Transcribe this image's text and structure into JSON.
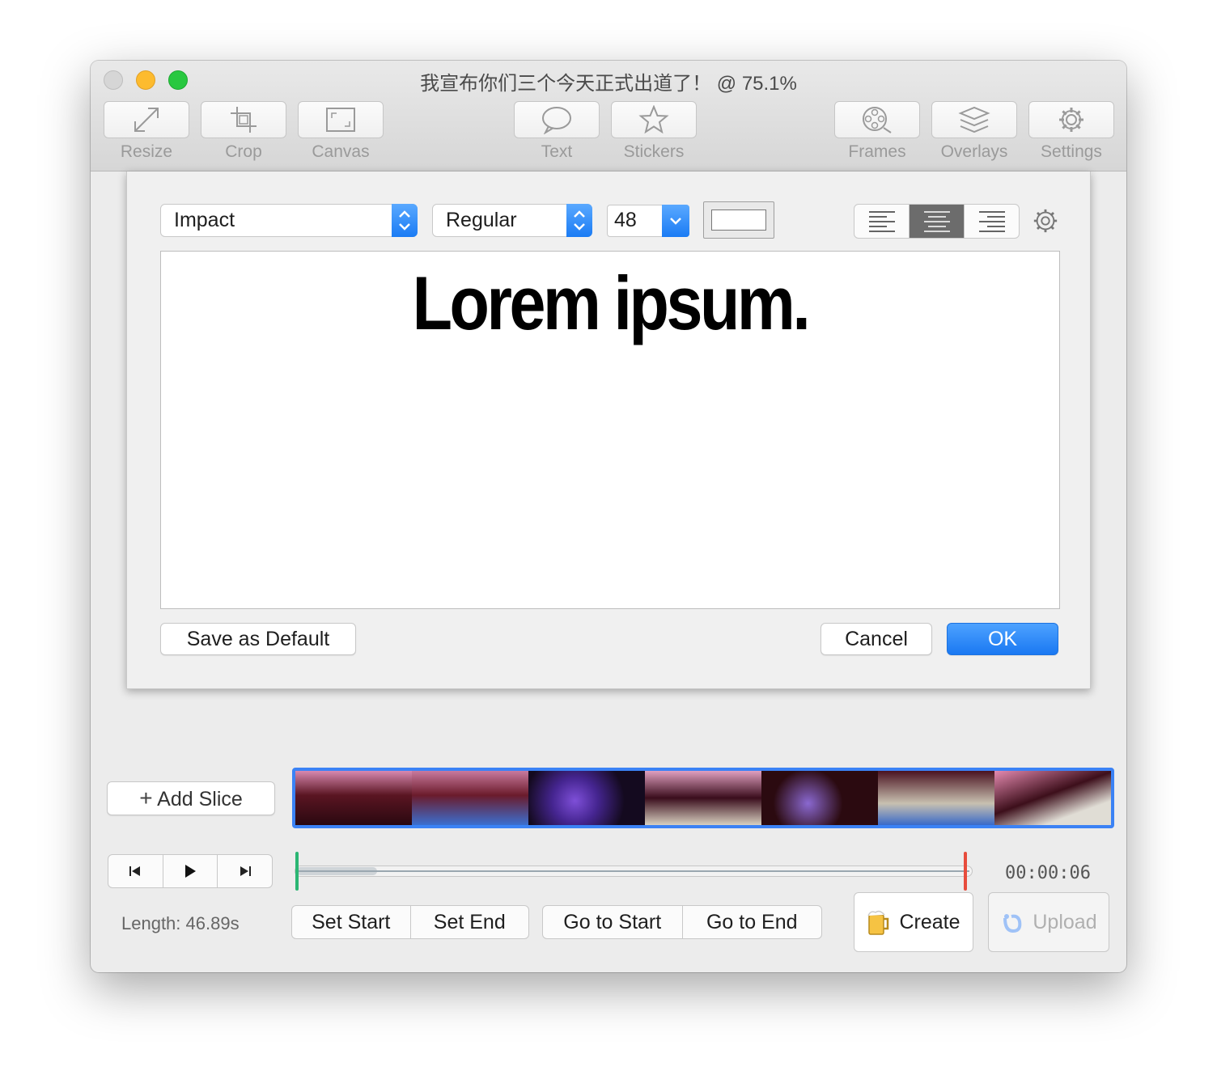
{
  "window": {
    "title": "我宣布你们三个今天正式出道了！  @ 75.1%"
  },
  "toolbar": {
    "items": [
      {
        "label": "Resize",
        "icon": "resize-icon"
      },
      {
        "label": "Crop",
        "icon": "crop-icon"
      },
      {
        "label": "Canvas",
        "icon": "canvas-icon"
      },
      {
        "label": "Text",
        "icon": "speech-bubble-icon"
      },
      {
        "label": "Stickers",
        "icon": "star-icon"
      },
      {
        "label": "Frames",
        "icon": "film-reel-icon"
      },
      {
        "label": "Overlays",
        "icon": "layers-icon"
      },
      {
        "label": "Settings",
        "icon": "gear-icon"
      }
    ]
  },
  "text_dialog": {
    "font": "Impact",
    "style": "Regular",
    "size": "48",
    "text_color": "#ffffff",
    "alignment_selected": "center",
    "text": "Lorem ipsum.",
    "save_default_label": "Save as Default",
    "cancel_label": "Cancel",
    "ok_label": "OK"
  },
  "slices": {
    "add_slice_label": "Add Slice",
    "frame_colors": [
      "#5a1522",
      "#6b1b2b",
      "#231033",
      "#3a0d1c",
      "#2b0a10",
      "#4a1220",
      "#3d0f1b"
    ]
  },
  "playback": {
    "timecode": "00:00:06",
    "length": "Length: 46.89s",
    "set_start_label": "Set Start",
    "set_end_label": "Set End",
    "go_to_start_label": "Go to Start",
    "go_to_end_label": "Go to End",
    "create_label": "Create",
    "upload_label": "Upload"
  },
  "colors": {
    "accent": "#1a78f2",
    "start_marker": "#2bb673",
    "end_marker": "#e74c3c"
  }
}
